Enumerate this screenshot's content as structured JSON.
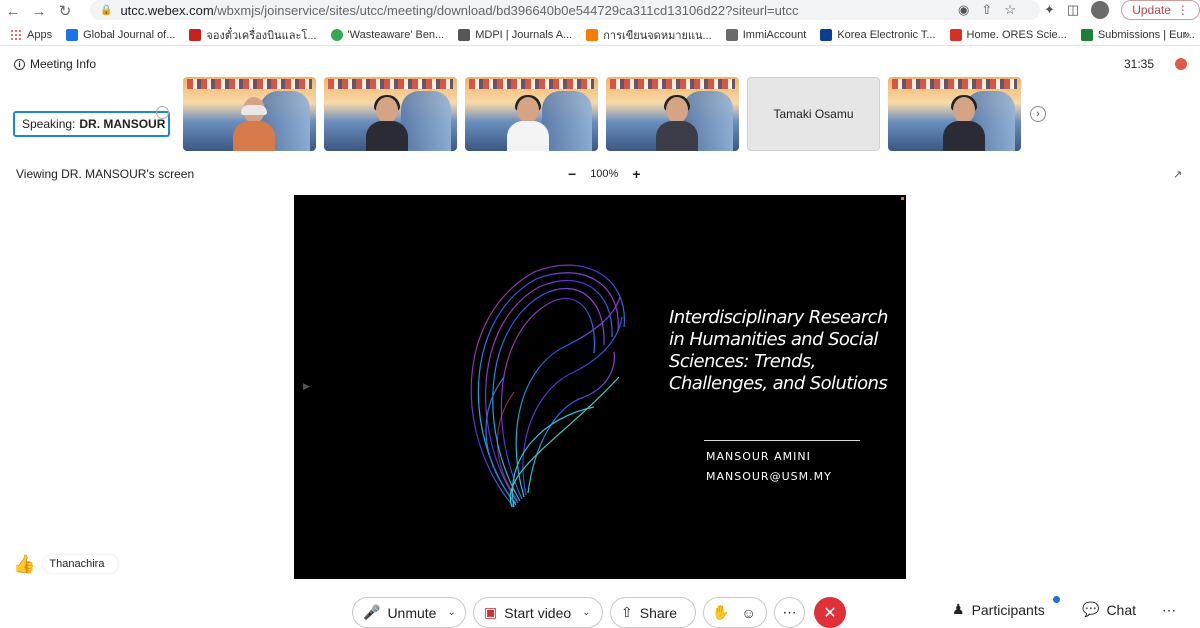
{
  "browser": {
    "url_host": "utcc.webex.com",
    "url_path": "/wbxmjs/joinservice/sites/utcc/meeting/download/bd396640b0e544729ca311cd13106d22?siteurl=utcc",
    "update_label": "Update"
  },
  "bookmarks": [
    {
      "label": "Apps",
      "color": "#e34133"
    },
    {
      "label": "Global Journal of...",
      "color": "#1a73e8"
    },
    {
      "label": "จองตั๋วเครื่องบินและโ...",
      "color": "#c5221f"
    },
    {
      "label": "'Wasteaware' Ben...",
      "color": "#34a853"
    },
    {
      "label": "MDPI | Journals A...",
      "color": "#555555"
    },
    {
      "label": "การเขียนจดหมายแน...",
      "color": "#f57c00"
    },
    {
      "label": "ImmiAccount",
      "color": "#6b6b6b"
    },
    {
      "label": "Korea Electronic T...",
      "color": "#0b3d91"
    },
    {
      "label": "Home. ORES Scie...",
      "color": "#d93025"
    },
    {
      "label": "Submissions | Eur...",
      "color": "#188038"
    }
  ],
  "meeting": {
    "info_label": "Meeting Info",
    "timer": "31:35",
    "speaking_prefix": "Speaking:",
    "speaking_name": "DR. MANSOUR",
    "viewing_label": "Viewing DR. MANSOUR's screen",
    "zoom_level": "100%",
    "name_tile": "Tamaki Osamu"
  },
  "slide": {
    "title_lines": [
      "Interdisciplinary Research",
      "in Humanities and Social",
      "Sciences: Trends,",
      "Challenges, and Solutions"
    ],
    "author": "MANSOUR AMINI",
    "email": "MANSOUR@USM.MY"
  },
  "reaction": {
    "name": "Thanachira"
  },
  "controls": {
    "unmute": "Unmute",
    "start_video": "Start video",
    "share": "Share",
    "participants": "Participants",
    "chat": "Chat"
  },
  "colors": {
    "accent": "#1a87d8",
    "end_call": "#e0313b"
  }
}
